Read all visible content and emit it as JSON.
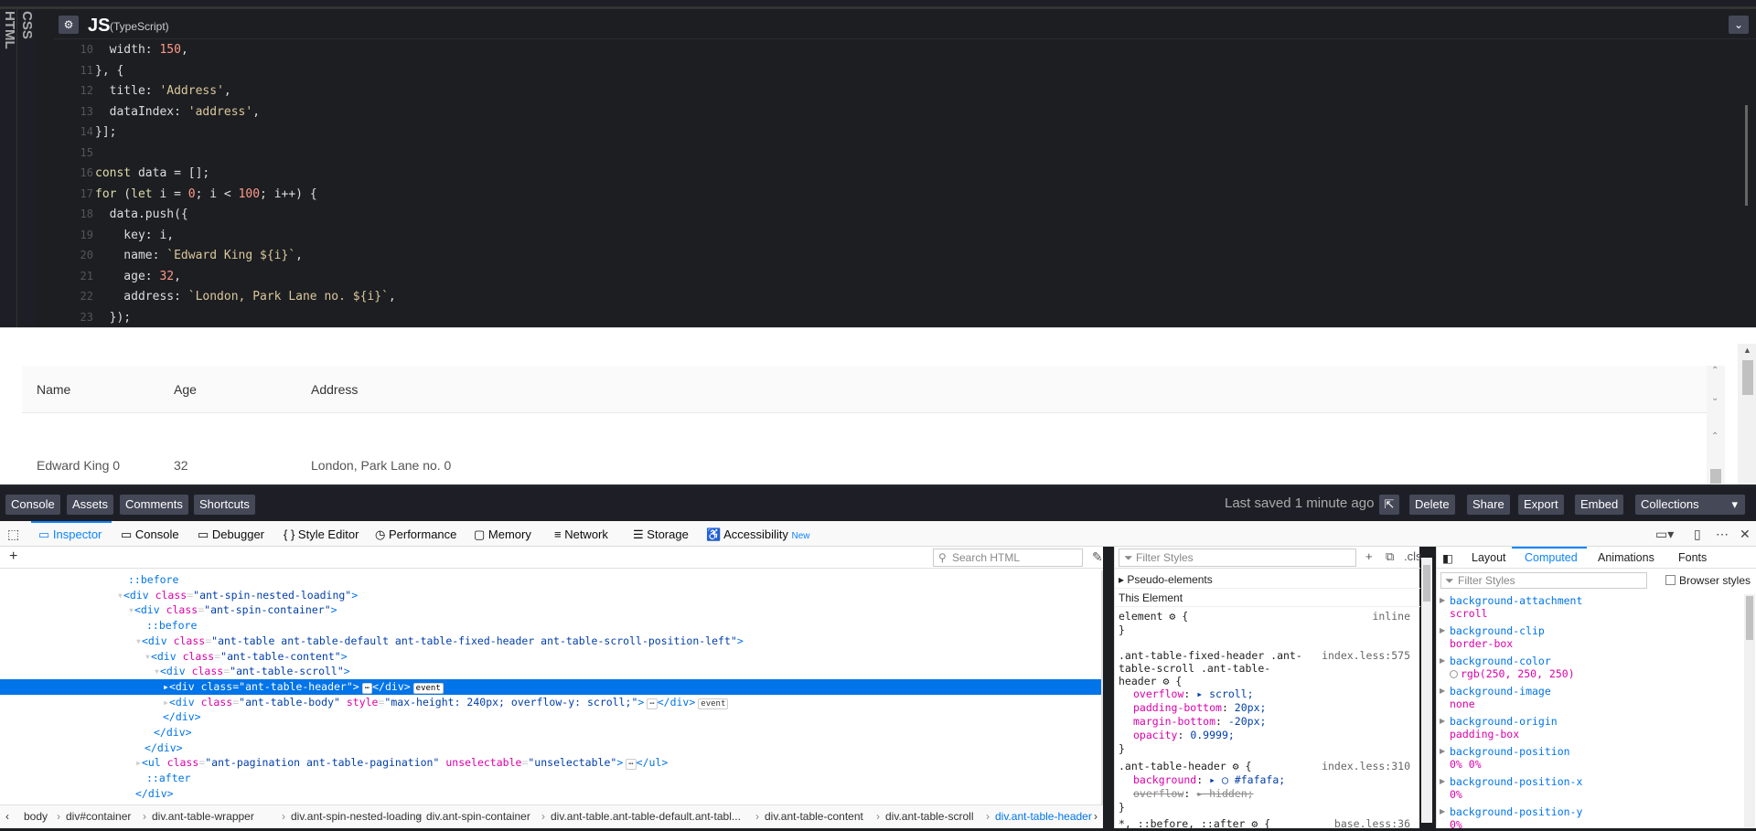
{
  "editor": {
    "vertical_tabs": {
      "html": "HTML",
      "css": "CSS"
    },
    "header": {
      "gear_icon": "⚙",
      "lang": "JS",
      "lang_sub": "(TypeScript)",
      "chevron_icon": "⌄"
    },
    "lines": [
      {
        "n": "10",
        "t": "  width: 150,"
      },
      {
        "n": "11",
        "t": "}, {"
      },
      {
        "n": "12",
        "t": "  title: 'Address',"
      },
      {
        "n": "13",
        "t": "  dataIndex: 'address',"
      },
      {
        "n": "14",
        "t": "}];"
      },
      {
        "n": "15",
        "t": ""
      },
      {
        "n": "16",
        "t": "const data = [];"
      },
      {
        "n": "17",
        "t": "for (let i = 0; i < 100; i++) {"
      },
      {
        "n": "18",
        "t": "  data.push({"
      },
      {
        "n": "19",
        "t": "    key: i,"
      },
      {
        "n": "20",
        "t": "    name: `Edward King ${i}`,"
      },
      {
        "n": "21",
        "t": "    age: 32,"
      },
      {
        "n": "22",
        "t": "    address: `London, Park Lane no. ${i}`,"
      },
      {
        "n": "23",
        "t": "  });"
      }
    ]
  },
  "preview": {
    "columns": [
      "Name",
      "Age",
      "Address"
    ],
    "row": [
      "Edward King 0",
      "32",
      "London, Park Lane no. 0"
    ]
  },
  "bottombar": {
    "left_buttons": [
      "Console",
      "Assets",
      "Comments",
      "Shortcuts"
    ],
    "last_saved": "Last saved 1 minute ago",
    "right_buttons": [
      "Delete",
      "Share",
      "Export",
      "Embed"
    ],
    "collections": "Collections"
  },
  "devtools": {
    "tabs": [
      "Inspector",
      "Console",
      "Debugger",
      "Style Editor",
      "Performance",
      "Memory",
      "Network",
      "Storage",
      "Accessibility"
    ],
    "new_badge": "New",
    "search_placeholder": "Search HTML",
    "tree": [
      {
        "indent": 140,
        "html": "<span class='pseudo'>::before</span>"
      },
      {
        "indent": 128,
        "html": "▾<span class='tag'>&lt;div</span> <span class='attr'>class</span>=<span class='aval'>\"ant-spin-nested-loading\"</span><span class='tag'>&gt;</span>"
      },
      {
        "indent": 140,
        "html": "▾<span class='tag'>&lt;div</span> <span class='attr'>class</span>=<span class='aval'>\"ant-spin-container\"</span><span class='tag'>&gt;</span>"
      },
      {
        "indent": 160,
        "html": "<span class='pseudo'>::before</span>"
      },
      {
        "indent": 148,
        "html": "▾<span class='tag'>&lt;div</span> <span class='attr'>class</span>=<span class='aval'>\"ant-table ant-table-default ant-table-fixed-header ant-table-scroll-position-left\"</span><span class='tag'>&gt;</span>"
      },
      {
        "indent": 158,
        "html": "▾<span class='tag'>&lt;div</span> <span class='attr'>class</span>=<span class='aval'>\"ant-table-content\"</span><span class='tag'>&gt;</span>"
      },
      {
        "indent": 168,
        "html": "▾<span class='tag'>&lt;div</span> <span class='attr'>class</span>=<span class='aval'>\"ant-table-scroll\"</span><span class='tag'>&gt;</span>"
      },
      {
        "indent": 178,
        "html": "▸<span class='tag'>&lt;div</span> <span class='attr'>class</span>=<span class='aval'>\"ant-table-header\"</span><span class='tag'>&gt;</span><span class='badge'>⋯</span><span class='tag'>&lt;/div&gt;</span><span class='badge'>event</span>",
        "selected": true
      },
      {
        "indent": 178,
        "html": "▸<span class='tag'>&lt;div</span> <span class='attr'>class</span>=<span class='aval'>\"ant-table-body\"</span> <span class='attr'>style</span>=<span class='aval'>\"max-height: 240px; overflow-y: scroll;\"</span><span class='tag'>&gt;</span><span class='badge'>⋯</span><span class='tag'>&lt;/div&gt;</span><span class='badge'>event</span>"
      },
      {
        "indent": 178,
        "html": "<span class='tag'>&lt;/div&gt;</span>"
      },
      {
        "indent": 168,
        "html": "<span class='tag'>&lt;/div&gt;</span>"
      },
      {
        "indent": 158,
        "html": "<span class='tag'>&lt;/div&gt;</span>"
      },
      {
        "indent": 148,
        "html": "▸<span class='tag'>&lt;ul</span> <span class='attr'>class</span>=<span class='aval'>\"ant-pagination ant-table-pagination\"</span> <span class='attr'>unselectable</span>=<span class='aval'>\"unselectable\"</span><span class='tag'>&gt;</span><span class='badge'>⋯</span><span class='tag'>&lt;/ul&gt;</span>"
      },
      {
        "indent": 160,
        "html": "<span class='pseudo'>::after</span>"
      },
      {
        "indent": 148,
        "html": "<span class='tag'>&lt;/div&gt;</span>"
      }
    ],
    "breadcrumbs": [
      "body",
      "div#container",
      "div.ant-table-wrapper",
      "div.ant-spin-nested-loading",
      "div.ant-spin-container",
      "div.ant-table.ant-table-default.ant-tabl...",
      "div.ant-table-content",
      "div.ant-table-scroll",
      "div.ant-table-header"
    ],
    "rules": {
      "filter_placeholder": "Filter Styles",
      "cls": ".cls",
      "pseudo_elements": "Pseudo-elements",
      "this_element": "This Element",
      "element_rule": "element ⚙ {",
      "element_src": "inline",
      "rule1_selector": ".ant-table-fixed-header .ant-",
      "rule1_selector2": "table-scroll .ant-table-",
      "rule1_selector3": "header ⚙ {",
      "rule1_src": "index.less:575",
      "rule1_decls": [
        {
          "p": "overflow",
          "v": "▸ scroll;"
        },
        {
          "p": "padding-bottom",
          "v": "20px;"
        },
        {
          "p": "margin-bottom",
          "v": "-20px;"
        },
        {
          "p": "opacity",
          "v": "0.9999;"
        }
      ],
      "rule2_selector": ".ant-table-header ⚙ {",
      "rule2_src": "index.less:310",
      "rule2_decls": [
        {
          "p": "background",
          "v": "▸ ◯ #fafafa;"
        },
        {
          "p": "overflow",
          "v": "▸ hidden;"
        }
      ],
      "rule3_selector": "*, ::before, ::after ⚙ {",
      "rule3_src": "base.less:36"
    },
    "computed": {
      "tabs": [
        "Layout",
        "Computed",
        "Animations",
        "Fonts"
      ],
      "filter_placeholder": "Filter Styles",
      "browser_styles": "Browser styles",
      "props": [
        {
          "p": "background-attachment",
          "v": "scroll"
        },
        {
          "p": "background-clip",
          "v": "border-box"
        },
        {
          "p": "background-color",
          "v": "rgb(250, 250, 250)"
        },
        {
          "p": "background-image",
          "v": "none"
        },
        {
          "p": "background-origin",
          "v": "padding-box"
        },
        {
          "p": "background-position",
          "v": "0% 0%"
        },
        {
          "p": "background-position-x",
          "v": "0%"
        },
        {
          "p": "background-position-y",
          "v": "0%"
        }
      ]
    }
  }
}
